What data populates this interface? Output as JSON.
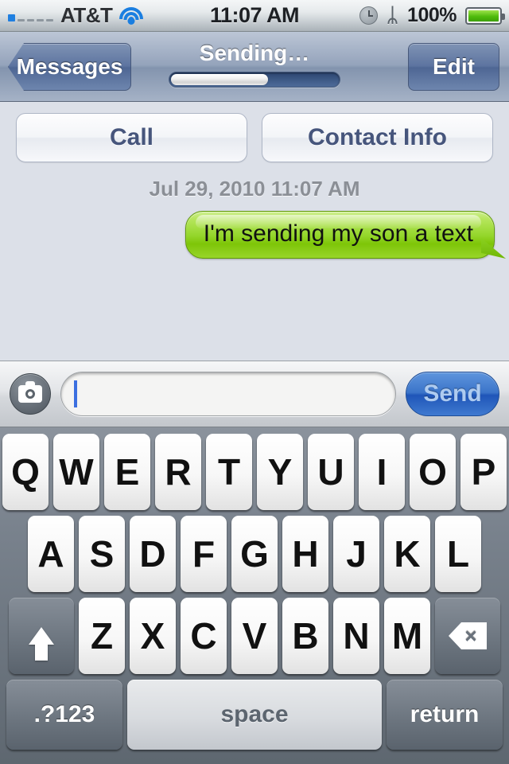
{
  "status_bar": {
    "carrier": "AT&T",
    "signal_bars_filled": 1,
    "signal_bars_total": 5,
    "wifi_icon": "wifi-icon",
    "time": "11:07 AM",
    "alarm_icon": "clock-icon",
    "bluetooth_icon": "bluetooth-icon",
    "battery_percent": "100%",
    "battery_level": 100,
    "battery_color": "#4fbb0c"
  },
  "nav_bar": {
    "back_label": "Messages",
    "title": "Sending…",
    "progress_percent": 58,
    "edit_label": "Edit"
  },
  "conversation": {
    "actions": [
      {
        "label": "Call",
        "name": "call-button"
      },
      {
        "label": "Contact Info",
        "name": "contact-info-button"
      }
    ],
    "timestamp": "Jul 29, 2010 11:07 AM",
    "messages": [
      {
        "text": "I'm sending my son a text",
        "side": "outgoing",
        "bubble_color": "#94d62b"
      }
    ]
  },
  "input_bar": {
    "camera_icon": "camera-icon",
    "field_value": "",
    "field_placeholder": "",
    "send_label": "Send"
  },
  "keyboard": {
    "row1": [
      "Q",
      "W",
      "E",
      "R",
      "T",
      "Y",
      "U",
      "I",
      "O",
      "P"
    ],
    "row2": [
      "A",
      "S",
      "D",
      "F",
      "G",
      "H",
      "J",
      "K",
      "L"
    ],
    "row3": [
      "Z",
      "X",
      "C",
      "V",
      "B",
      "N",
      "M"
    ],
    "shift_icon": "shift-arrow-icon",
    "delete_icon": "delete-backspace-icon",
    "delete_glyph": "×",
    "numbers_label": ".?123",
    "space_label": "space",
    "return_label": "return"
  },
  "colors": {
    "accent_blue": "#2d6fd0",
    "bubble_green": "#94d62b",
    "nav_blue": "#8394ae",
    "keyboard_gray": "#6c757f"
  }
}
